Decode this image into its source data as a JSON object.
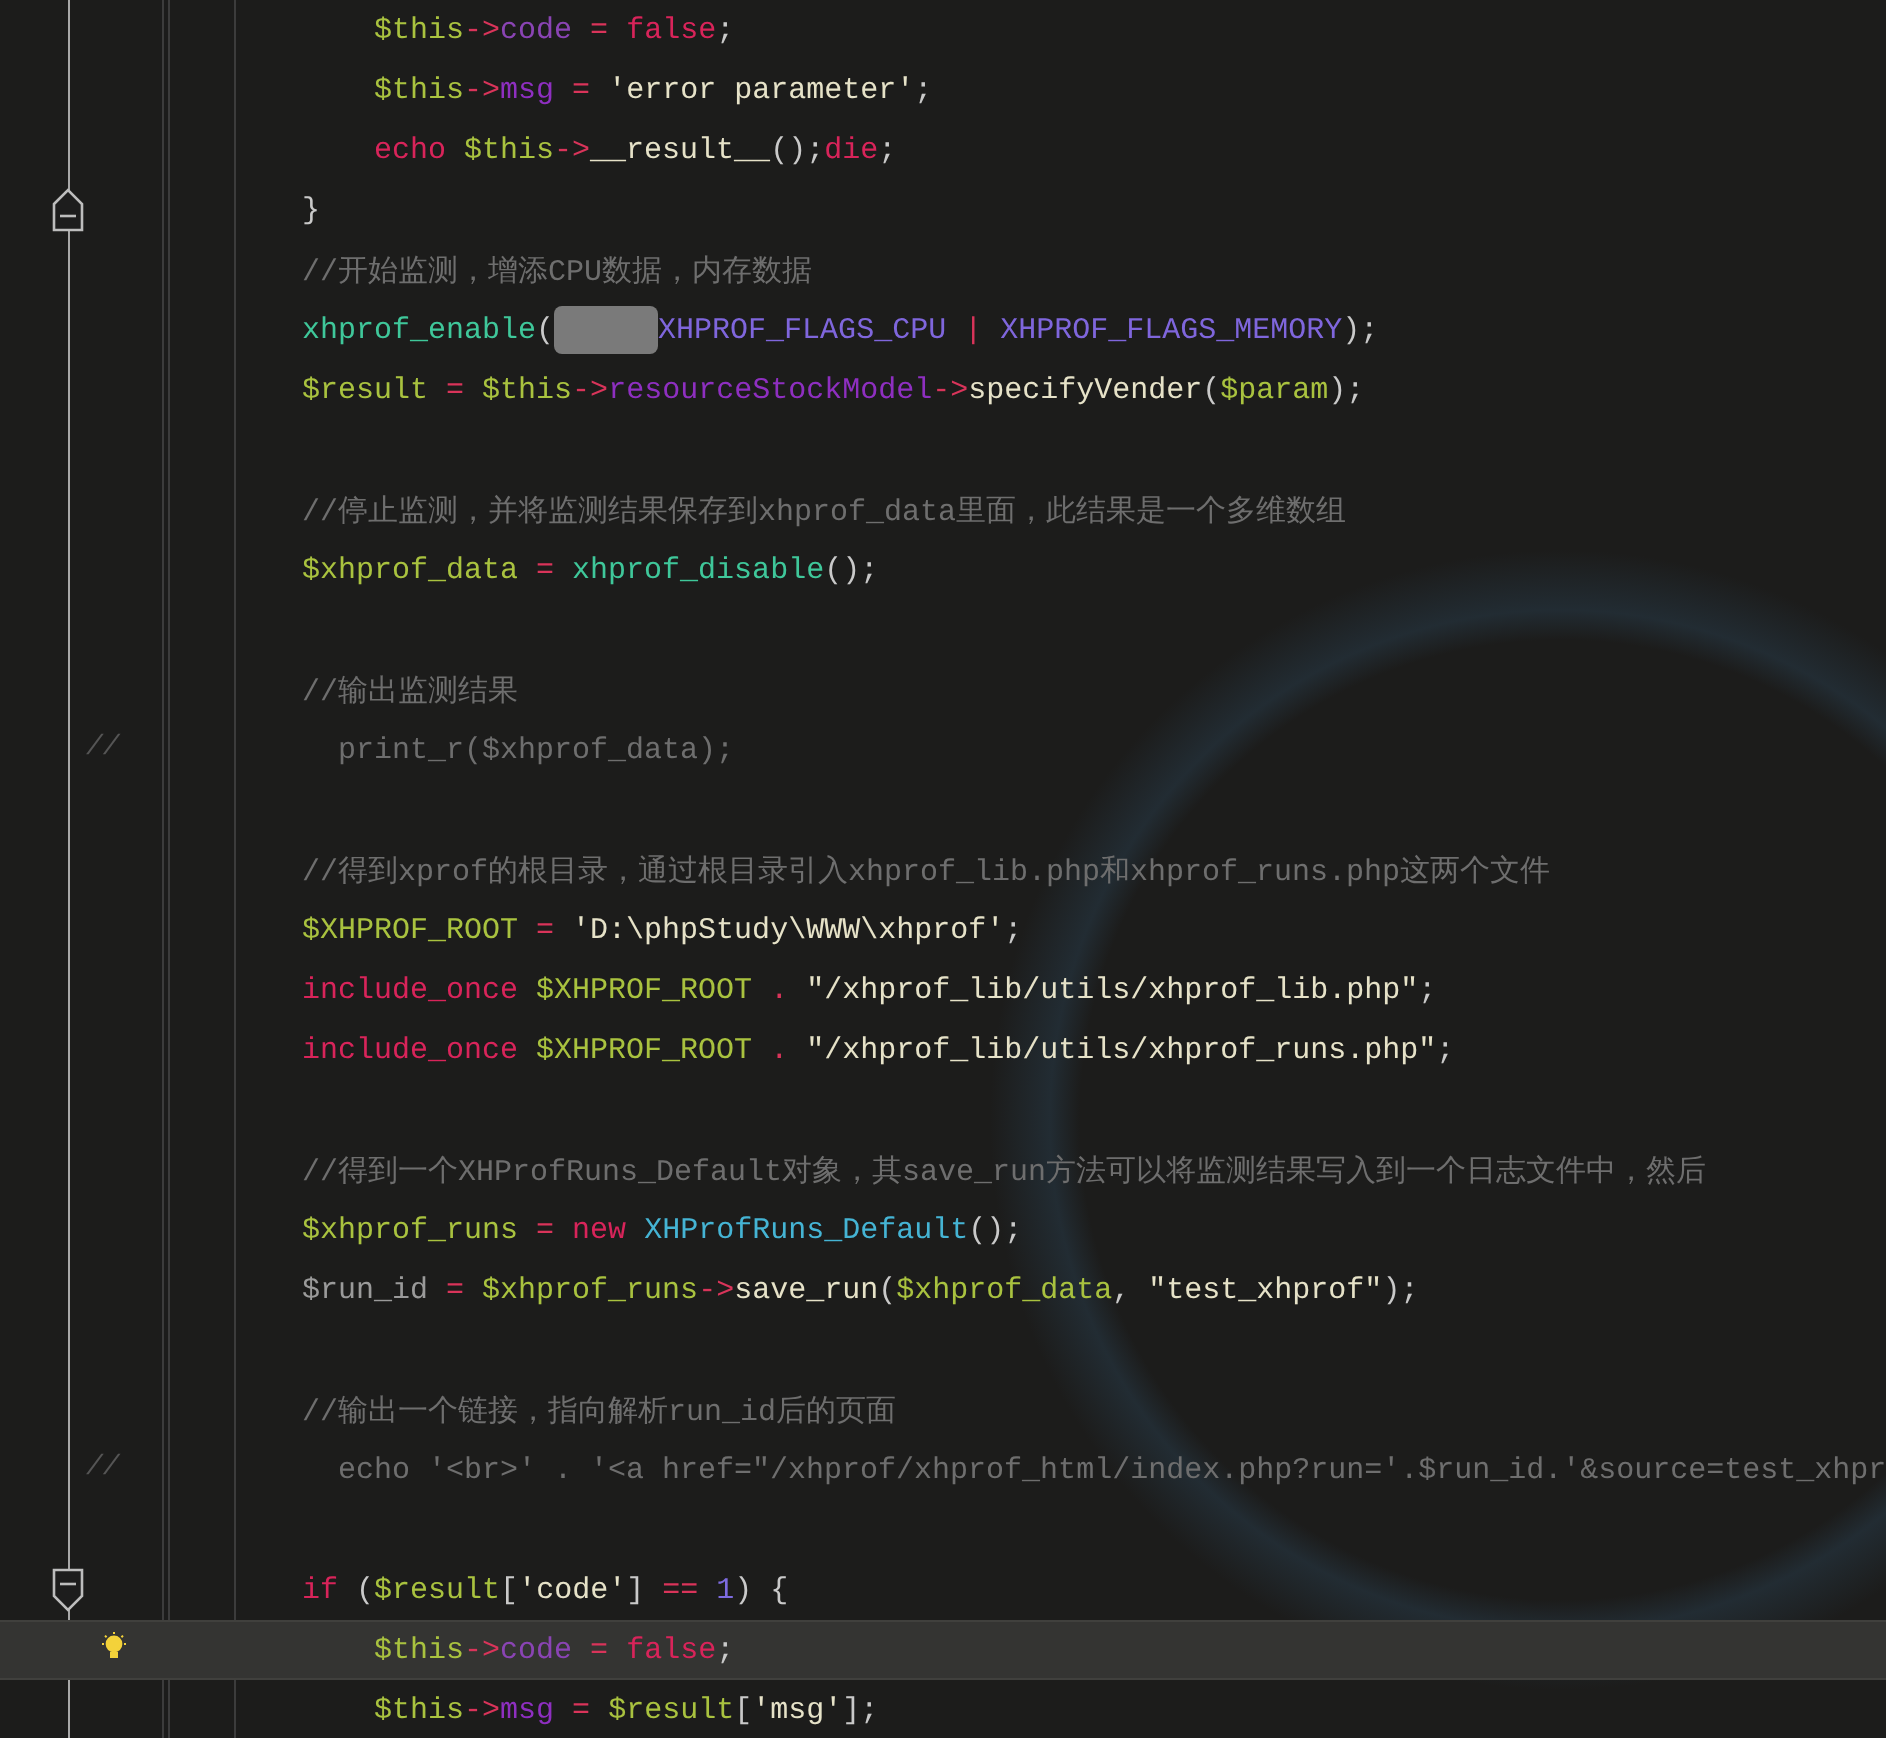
{
  "editor": {
    "lines": [
      {
        "kind": "code",
        "current": false,
        "tokens": [
          {
            "kind": "var",
            "text": "    $this"
          },
          {
            "kind": "op",
            "text": "->"
          },
          {
            "kind": "prop-dim",
            "text": "code"
          },
          {
            "kind": "op",
            "text": " = "
          },
          {
            "kind": "keyword",
            "text": "false"
          },
          {
            "kind": "plain",
            "text": ";"
          }
        ]
      },
      {
        "kind": "code",
        "current": false,
        "tokens": [
          {
            "kind": "var",
            "text": "    $this"
          },
          {
            "kind": "op",
            "text": "->"
          },
          {
            "kind": "prop",
            "text": "msg"
          },
          {
            "kind": "op",
            "text": " = "
          },
          {
            "kind": "string",
            "text": "'error parameter'"
          },
          {
            "kind": "plain",
            "text": ";"
          }
        ]
      },
      {
        "kind": "code",
        "current": false,
        "tokens": [
          {
            "kind": "keyword",
            "text": "    echo "
          },
          {
            "kind": "var",
            "text": "$this"
          },
          {
            "kind": "op",
            "text": "->"
          },
          {
            "kind": "string",
            "text": "__result__"
          },
          {
            "kind": "plain",
            "text": "();"
          },
          {
            "kind": "keyword",
            "text": "die"
          },
          {
            "kind": "plain",
            "text": ";"
          }
        ]
      },
      {
        "kind": "fold-end",
        "current": false,
        "tokens": [
          {
            "kind": "plain",
            "text": "}"
          }
        ]
      },
      {
        "kind": "code",
        "current": false,
        "tokens": [
          {
            "kind": "comment",
            "text": "//开始监测，增添CPU数据，内存数据"
          }
        ]
      },
      {
        "kind": "code",
        "current": false,
        "tokens": [
          {
            "kind": "func",
            "text": "xhprof_enable"
          },
          {
            "kind": "plain",
            "text": "("
          },
          {
            "kind": "redacted"
          },
          {
            "kind": "const",
            "text": "XHPROF_FLAGS_CPU"
          },
          {
            "kind": "op",
            "text": " | "
          },
          {
            "kind": "const",
            "text": "XHPROF_FLAGS_MEMORY"
          },
          {
            "kind": "plain",
            "text": ");"
          }
        ]
      },
      {
        "kind": "code",
        "current": false,
        "tokens": [
          {
            "kind": "var",
            "text": "$result"
          },
          {
            "kind": "op",
            "text": " = "
          },
          {
            "kind": "var",
            "text": "$this"
          },
          {
            "kind": "op",
            "text": "->"
          },
          {
            "kind": "prop",
            "text": "resourceStockModel"
          },
          {
            "kind": "op",
            "text": "->"
          },
          {
            "kind": "string",
            "text": "specifyVender"
          },
          {
            "kind": "plain",
            "text": "("
          },
          {
            "kind": "var",
            "text": "$param"
          },
          {
            "kind": "plain",
            "text": ");"
          }
        ]
      },
      {
        "kind": "code",
        "current": false
      },
      {
        "kind": "code",
        "current": false,
        "tokens": [
          {
            "kind": "comment",
            "text": "//停止监测，并将监测结果保存到xhprof_data里面，此结果是一个多维数组"
          }
        ]
      },
      {
        "kind": "code",
        "current": false,
        "tokens": [
          {
            "kind": "var",
            "text": "$xhprof_data"
          },
          {
            "kind": "op",
            "text": " = "
          },
          {
            "kind": "func",
            "text": "xhprof_disable"
          },
          {
            "kind": "plain",
            "text": "();"
          }
        ]
      },
      {
        "kind": "code",
        "current": false
      },
      {
        "kind": "code",
        "current": false,
        "tokens": [
          {
            "kind": "comment",
            "text": "//输出监测结果"
          }
        ]
      },
      {
        "kind": "code",
        "current": false,
        "gutter": "//",
        "tokens": [
          {
            "kind": "comment",
            "text": "  print_r($xhprof_data);"
          }
        ]
      },
      {
        "kind": "code",
        "current": false
      },
      {
        "kind": "code",
        "current": false,
        "tokens": [
          {
            "kind": "comment",
            "text": "//得到xprof的根目录，通过根目录引入xhprof_lib.php和xhprof_runs.php这两个文件"
          }
        ]
      },
      {
        "kind": "code",
        "current": false,
        "tokens": [
          {
            "kind": "var",
            "text": "$XHPROF_ROOT"
          },
          {
            "kind": "op",
            "text": " = "
          },
          {
            "kind": "string",
            "text": "'D:\\phpStudy\\WWW\\xhprof'"
          },
          {
            "kind": "plain",
            "text": ";"
          }
        ]
      },
      {
        "kind": "code",
        "current": false,
        "tokens": [
          {
            "kind": "keyword",
            "text": "include_once "
          },
          {
            "kind": "var",
            "text": "$XHPROF_ROOT"
          },
          {
            "kind": "op",
            "text": " . "
          },
          {
            "kind": "string",
            "text": "\"/xhprof_lib/utils/xhprof_lib.php\""
          },
          {
            "kind": "plain",
            "text": ";"
          }
        ]
      },
      {
        "kind": "code",
        "current": false,
        "tokens": [
          {
            "kind": "keyword",
            "text": "include_once "
          },
          {
            "kind": "var",
            "text": "$XHPROF_ROOT"
          },
          {
            "kind": "op",
            "text": " . "
          },
          {
            "kind": "string",
            "text": "\"/xhprof_lib/utils/xhprof_runs.php\""
          },
          {
            "kind": "plain",
            "text": ";"
          }
        ]
      },
      {
        "kind": "code",
        "current": false
      },
      {
        "kind": "code",
        "current": false,
        "tokens": [
          {
            "kind": "comment",
            "text": "//得到一个XHProfRuns_Default对象，其save_run方法可以将监测结果写入到一个日志文件中，然后"
          }
        ]
      },
      {
        "kind": "code",
        "current": false,
        "tokens": [
          {
            "kind": "var",
            "text": "$xhprof_runs"
          },
          {
            "kind": "op",
            "text": " = "
          },
          {
            "kind": "keyword",
            "text": "new "
          },
          {
            "kind": "class",
            "text": "XHProfRuns_Default"
          },
          {
            "kind": "plain",
            "text": "();"
          }
        ]
      },
      {
        "kind": "code",
        "current": false,
        "tokens": [
          {
            "kind": "unused",
            "text": "$run_id"
          },
          {
            "kind": "op",
            "text": " = "
          },
          {
            "kind": "var",
            "text": "$xhprof_runs"
          },
          {
            "kind": "op",
            "text": "->"
          },
          {
            "kind": "string",
            "text": "save_run"
          },
          {
            "kind": "plain",
            "text": "("
          },
          {
            "kind": "var",
            "text": "$xhprof_data"
          },
          {
            "kind": "plain",
            "text": ", "
          },
          {
            "kind": "string",
            "text": "\"test_xhprof\""
          },
          {
            "kind": "plain",
            "text": ");"
          }
        ]
      },
      {
        "kind": "code",
        "current": false
      },
      {
        "kind": "code",
        "current": false,
        "tokens": [
          {
            "kind": "comment",
            "text": "//输出一个链接，指向解析run_id后的页面"
          }
        ]
      },
      {
        "kind": "code",
        "current": false,
        "gutter": "//",
        "tokens": [
          {
            "kind": "comment",
            "text": "  echo '<br>' . '<a href=\"/xhprof/xhprof_html/index.php?run='.$run_id.'&source=test_xhpr"
          }
        ]
      },
      {
        "kind": "code",
        "current": false
      },
      {
        "kind": "fold-start",
        "current": false,
        "tokens": [
          {
            "kind": "keyword",
            "text": "if"
          },
          {
            "kind": "plain",
            "text": " ("
          },
          {
            "kind": "var",
            "text": "$result"
          },
          {
            "kind": "plain",
            "text": "["
          },
          {
            "kind": "string",
            "text": "'code'"
          },
          {
            "kind": "plain",
            "text": "] "
          },
          {
            "kind": "op",
            "text": "== "
          },
          {
            "kind": "number",
            "text": "1"
          },
          {
            "kind": "plain",
            "text": ") {"
          }
        ]
      },
      {
        "kind": "code",
        "current": true,
        "tokens": [
          {
            "kind": "var",
            "text": "    $this"
          },
          {
            "kind": "op",
            "text": "->"
          },
          {
            "kind": "prop-dim",
            "text": "code"
          },
          {
            "kind": "op",
            "text": " = "
          },
          {
            "kind": "keyword",
            "text": "false"
          },
          {
            "kind": "plain",
            "text": ";"
          }
        ]
      },
      {
        "kind": "code",
        "current": false,
        "tokens": [
          {
            "kind": "var",
            "text": "    $this"
          },
          {
            "kind": "op",
            "text": "->"
          },
          {
            "kind": "prop",
            "text": "msg"
          },
          {
            "kind": "op",
            "text": " = "
          },
          {
            "kind": "var",
            "text": "$result"
          },
          {
            "kind": "plain",
            "text": "["
          },
          {
            "kind": "string",
            "text": "'msg'"
          },
          {
            "kind": "plain",
            "text": "];"
          }
        ]
      }
    ]
  }
}
